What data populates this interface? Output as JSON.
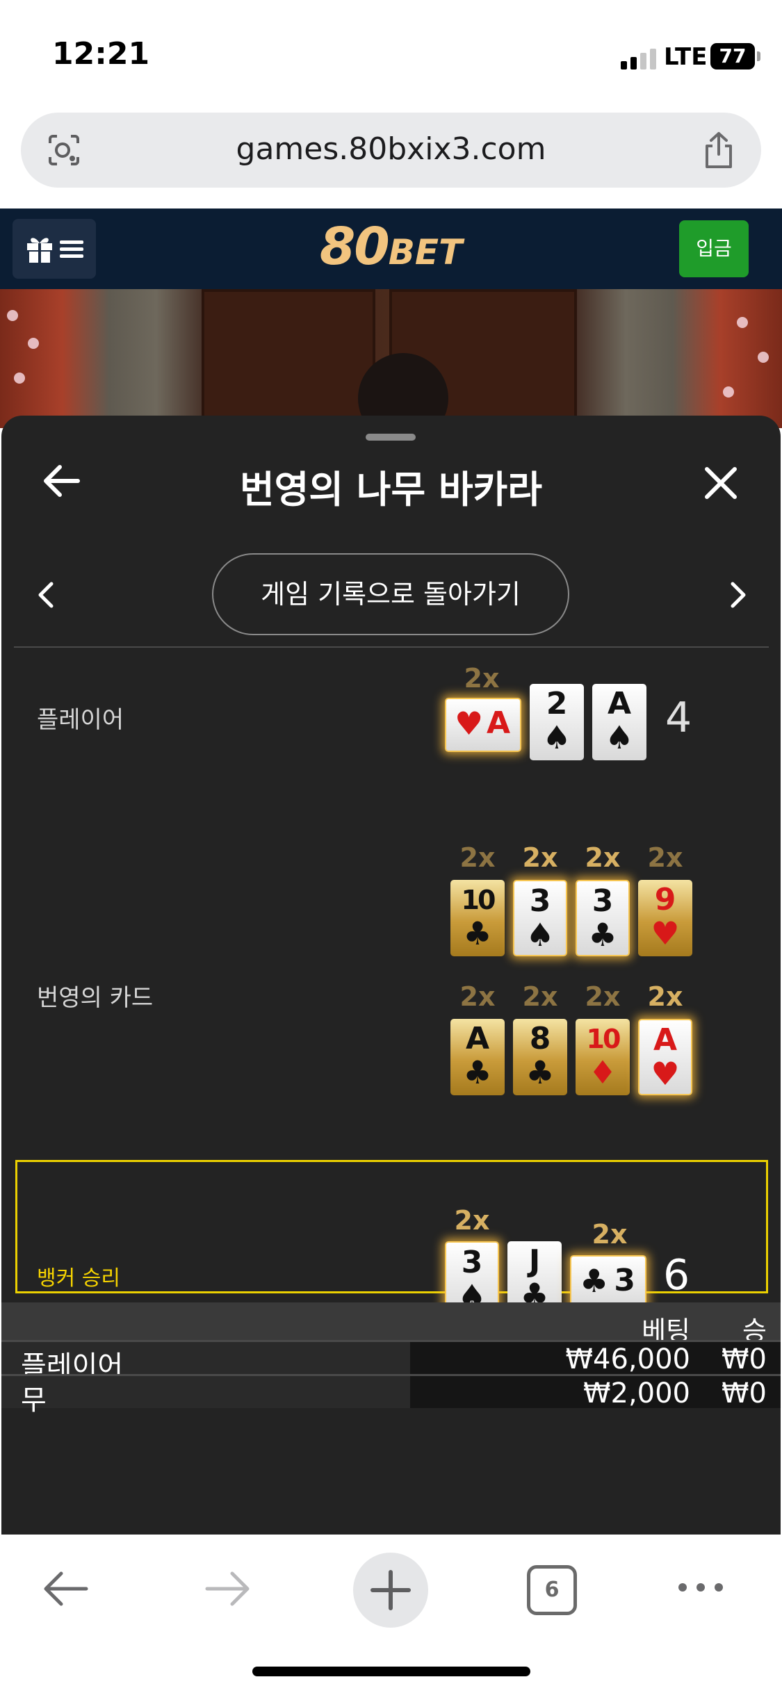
{
  "status_bar": {
    "time": "12:21",
    "network": "LTE",
    "battery": "77"
  },
  "browser": {
    "url": "games.80bxix3.com",
    "tab_count": "6"
  },
  "site": {
    "logo_num": "80",
    "logo_text": "BET",
    "deposit_label": "입금"
  },
  "sheet": {
    "title": "번영의 나무 바카라",
    "history_button": "게임 기록으로 돌아가기"
  },
  "result": {
    "player": {
      "label": "플레이어",
      "total": "4",
      "multiplier": "2x",
      "cards": [
        {
          "rank": "A",
          "suit": "♥",
          "color": "red",
          "orientation": "side"
        },
        {
          "rank": "2",
          "suit": "♠",
          "color": "black"
        },
        {
          "rank": "A",
          "suit": "♠",
          "color": "black"
        }
      ]
    },
    "fortune": {
      "label": "번영의 카드",
      "multiplier": "2x",
      "row1": [
        {
          "rank": "10",
          "suit": "♣",
          "color": "black",
          "style": "gold"
        },
        {
          "rank": "3",
          "suit": "♠",
          "color": "black",
          "style": "white-glow"
        },
        {
          "rank": "3",
          "suit": "♣",
          "color": "black",
          "style": "white-glow"
        },
        {
          "rank": "9",
          "suit": "♥",
          "color": "red",
          "style": "gold"
        }
      ],
      "row2": [
        {
          "rank": "A",
          "suit": "♣",
          "color": "black",
          "style": "gold"
        },
        {
          "rank": "8",
          "suit": "♣",
          "color": "black",
          "style": "gold"
        },
        {
          "rank": "10",
          "suit": "♦",
          "color": "red",
          "style": "gold"
        },
        {
          "rank": "A",
          "suit": "♥",
          "color": "red",
          "style": "white-glow"
        }
      ]
    },
    "banker": {
      "label": "뱅커 승리",
      "total": "6",
      "multiplier": "2x",
      "cards": [
        {
          "rank": "3",
          "suit": "♠",
          "color": "black"
        },
        {
          "rank": "J",
          "suit": "♣",
          "color": "black"
        },
        {
          "rank": "3",
          "suit": "♣",
          "color": "black",
          "orientation": "side"
        }
      ]
    }
  },
  "bets": {
    "headers": {
      "bet": "베팅",
      "win": "승"
    },
    "rows": [
      {
        "name": "플레이어",
        "amount": "₩46,000",
        "win": "₩0"
      },
      {
        "name": "무",
        "amount": "₩2,000",
        "win": "₩0"
      }
    ]
  },
  "colors": {
    "header_bg": "#0b1d33",
    "deposit_green": "#1f9c2a",
    "win_yellow": "#ecd100",
    "logo_gold": "#f2c47f"
  }
}
